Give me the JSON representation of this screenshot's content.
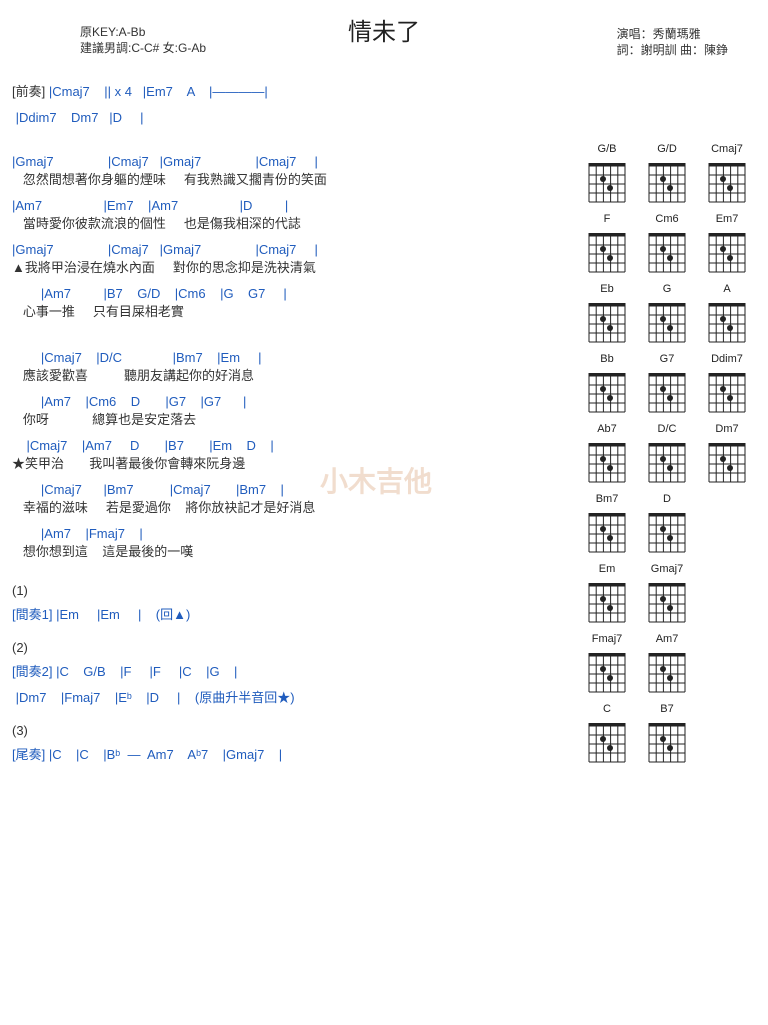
{
  "title": "情未了",
  "meta_left": {
    "key": "原KEY:A-Bb",
    "suggest": "建議男調:C-C# 女:G-Ab"
  },
  "meta_right": {
    "singer": "演唱：秀蘭瑪雅",
    "credits": "詞：謝明訓     曲：陳錚"
  },
  "intro": {
    "mark": "[前奏]",
    "l1": " |Cmaj7    || x 4   |Em7    A    |————|",
    "l2": " |Ddim7    Dm7   |D     |"
  },
  "verse1": {
    "c1": "|Gmaj7               |Cmaj7   |Gmaj7               |Cmaj7     |",
    "l1": "   忽然間想著你身軀的煙味     有我熟識又擱青份的笑面",
    "c2": "|Am7                 |Em7    |Am7                 |D         |",
    "l2": "   當時愛你彼款流浪的個性     也是傷我相深的代誌",
    "c3": "|Gmaj7               |Cmaj7   |Gmaj7               |Cmaj7     |",
    "l3": "▲我將甲治浸在燒水內面     對你的思念抑是洗袂清氣",
    "c4": "        |Am7         |B7    G/D    |Cm6    |G    G7     |",
    "l4": "   心事一推     只有目屎相老實"
  },
  "chorus": {
    "c1": "        |Cmaj7    |D/C              |Bm7    |Em     |",
    "l1": "   應該愛歡喜          聽朋友講起你的好消息",
    "c2": "        |Am7    |Cm6    D       |G7    |G7      |",
    "l2": "   你呀            總算也是安定落去",
    "c3": "    |Cmaj7    |Am7     D       |B7       |Em    D    |",
    "l3": "★笑甲治       我叫著最後你會轉來阮身邊",
    "c4": "        |Cmaj7      |Bm7          |Cmaj7       |Bm7    |",
    "l4": "   幸福的滋味     若是愛過你    將你放袂記才是好消息",
    "c5": "        |Am7    |Fmaj7    |",
    "l5": "   想你想到這    這是最後的一嘆"
  },
  "sections": {
    "s1mark": "(1)",
    "s1": "[間奏1] |Em     |Em     |    (回▲)",
    "s2mark": "(2)",
    "s2a": "[間奏2] |C    G/B    |F     |F     |C    |G    |",
    "s2b": " |Dm7    |Fmaj7    |Eᵇ    |D     |    (原曲升半音回★)",
    "s3mark": "(3)",
    "s3": "[尾奏] |C    |C    |Bᵇ  —  Am7    Aᵇ7    |Gmaj7    |"
  },
  "chord_diagrams": [
    "G/B",
    "G/D",
    "Cmaj7",
    "F",
    "Cm6",
    "Em7",
    "Eb",
    "G",
    "A",
    "Bb",
    "G7",
    "Ddim7",
    "Ab7",
    "D/C",
    "Dm7",
    "Bm7",
    "D",
    "",
    "Em",
    "Gmaj7",
    "",
    "Fmaj7",
    "Am7",
    "",
    "C",
    "B7",
    ""
  ],
  "watermark": "小木吉他"
}
